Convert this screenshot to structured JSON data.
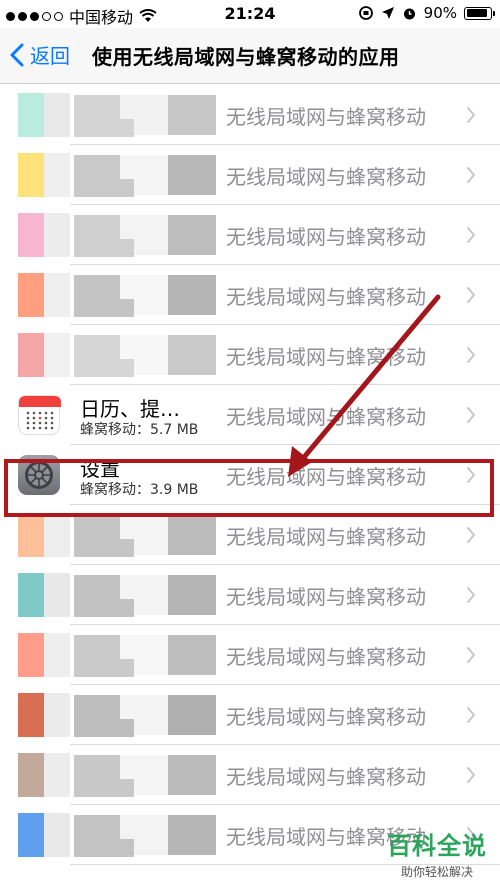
{
  "status_bar": {
    "carrier": "中国移动",
    "time": "21:24",
    "battery": "90%",
    "battery_level": 0.9
  },
  "nav": {
    "back_label": "返回",
    "title": "使用无线局域网与蜂窝移动的应用"
  },
  "rows": [
    {
      "name": "",
      "usage": "",
      "value": "无线局域网与蜂窝移动",
      "obscured": true
    },
    {
      "name": "",
      "usage": "",
      "value": "无线局域网与蜂窝移动",
      "obscured": true
    },
    {
      "name": "",
      "usage": "",
      "value": "无线局域网与蜂窝移动",
      "obscured": true
    },
    {
      "name": "",
      "usage": "",
      "value": "无线局域网与蜂窝移动",
      "obscured": true
    },
    {
      "name": "",
      "usage": "",
      "value": "无线局域网与蜂窝移动",
      "obscured": true
    },
    {
      "name": "日历、提…",
      "usage": "蜂窝移动：5.7 MB",
      "value": "无线局域网与蜂窝移动",
      "obscured": false,
      "icon": "calendar-icon"
    },
    {
      "name": "设置",
      "usage": "蜂窝移动：3.9 MB",
      "value": "无线局域网与蜂窝移动",
      "obscured": false,
      "icon": "settings-gear-icon",
      "highlighted": true
    },
    {
      "name": "",
      "usage": "",
      "value": "无线局域网与蜂窝移动",
      "obscured": true
    },
    {
      "name": "",
      "usage": "",
      "value": "无线局域网与蜂窝移动",
      "obscured": true
    },
    {
      "name": "",
      "usage": "",
      "value": "无线局域网与蜂窝移动",
      "obscured": true
    },
    {
      "name": "",
      "usage": "",
      "value": "无线局域网与蜂窝移动",
      "obscured": true
    },
    {
      "name": "",
      "usage": "",
      "value": "无线局域网与蜂窝移动",
      "obscured": true
    },
    {
      "name": "",
      "usage": "",
      "value": "无线局域网与蜂窝移动",
      "obscured": true
    }
  ],
  "watermark": {
    "big": "百科全说",
    "small": "助你轻松解决"
  },
  "colors": {
    "ios_blue": "#0a7aff",
    "highlight_red": "#b0181f",
    "watermark_green": "#2aa55b"
  }
}
